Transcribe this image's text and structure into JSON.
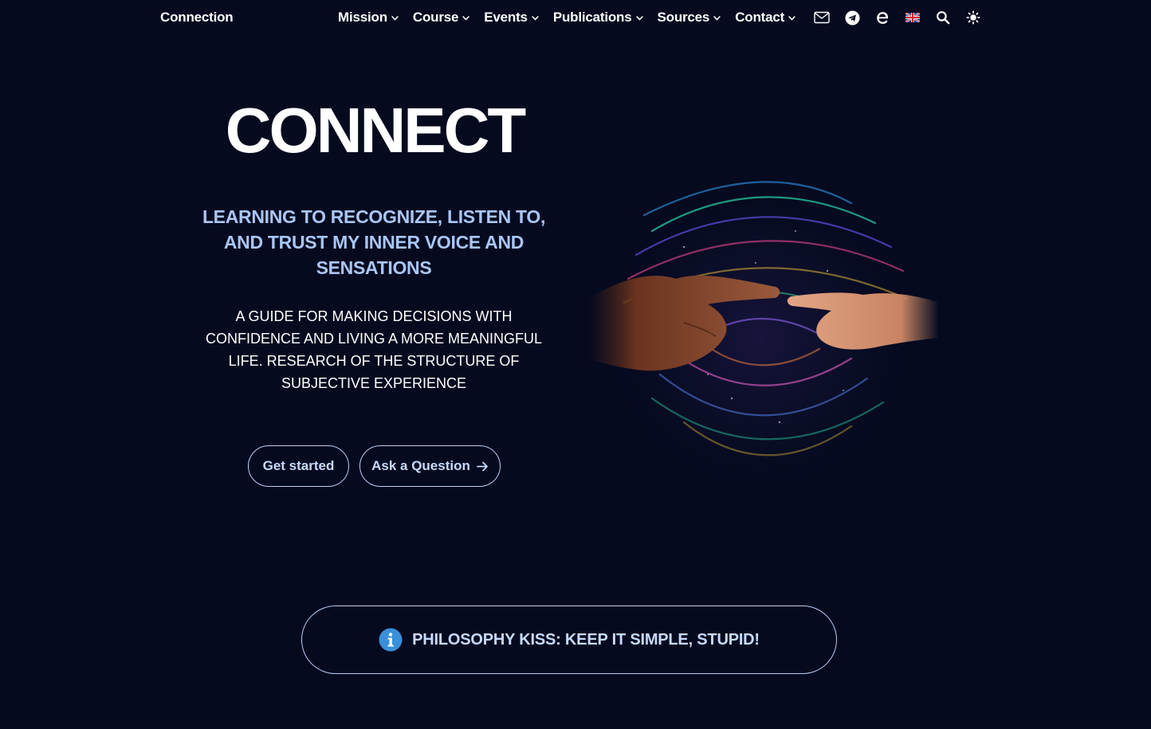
{
  "nav": {
    "brand": "Connection",
    "menu": [
      {
        "label": "Mission"
      },
      {
        "label": "Course"
      },
      {
        "label": "Events"
      },
      {
        "label": "Publications"
      },
      {
        "label": "Sources"
      },
      {
        "label": "Contact"
      }
    ],
    "icons": [
      "mail-icon",
      "telegram-icon",
      "e-logo-icon",
      "uk-flag-icon",
      "search-icon",
      "theme-toggle-icon"
    ]
  },
  "hero": {
    "title": "CONNECT",
    "subtitle": "LEARNING TO RECOGNIZE, LISTEN TO, AND TRUST MY INNER VOICE AND SENSATIONS",
    "description": "A GUIDE FOR MAKING DECISIONS WITH CONFIDENCE AND LIVING A MORE MEANINGFUL LIFE. RESEARCH OF THE STRUCTURE OF SUBJECTIVE EXPERIENCE",
    "primary_button": "Get started",
    "secondary_button": "Ask a Question"
  },
  "callout": {
    "text": "PHILOSOPHY KISS: KEEP IT SIMPLE, STUPID!",
    "icon": "info-icon"
  },
  "colors": {
    "background": "#050a1f",
    "accent": "#a9c6f5",
    "info_blue": "#3a8fd8"
  }
}
